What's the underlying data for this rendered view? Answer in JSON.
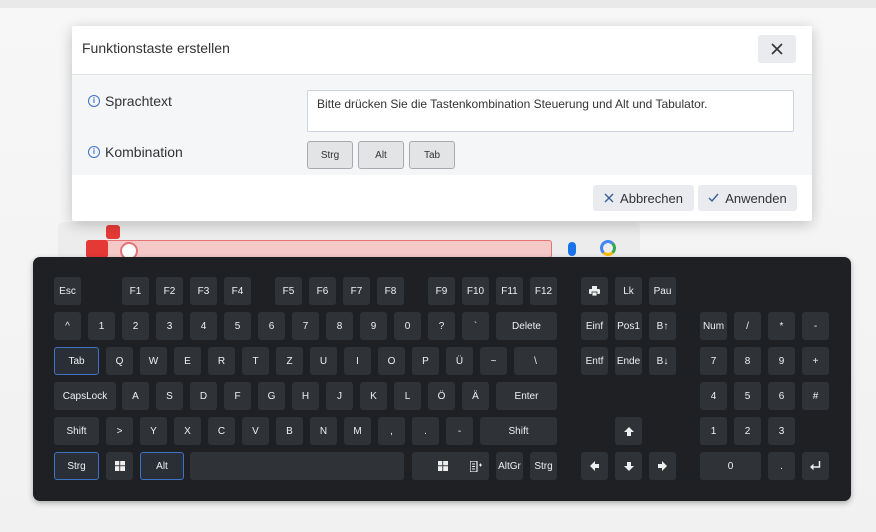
{
  "dialog": {
    "title": "Funktionstaste erstellen",
    "speech_label": "Sprachtext",
    "speech_text": "Bitte drücken Sie die Tastenkombination Steuerung und Alt und Tabulator.",
    "combo_label": "Kombination",
    "combination": [
      "Strg",
      "Alt",
      "Tab"
    ],
    "cancel_label": "Abbrechen",
    "apply_label": "Anwenden"
  },
  "keyboard": {
    "active_keys": [
      "Tab",
      "Strg",
      "Alt"
    ],
    "rows": [
      [
        "Esc",
        "F1",
        "F2",
        "F3",
        "F4",
        "F5",
        "F6",
        "F7",
        "F8",
        "F9",
        "F10",
        "F11",
        "F12",
        "print-icon",
        "Lk",
        "Pau"
      ],
      [
        "^",
        "1",
        "2",
        "3",
        "4",
        "5",
        "6",
        "7",
        "8",
        "9",
        "0",
        "?",
        "`",
        "Delete",
        "Einf",
        "Pos1",
        "B↑",
        "Num",
        "/",
        "*",
        "-"
      ],
      [
        "Tab",
        "Q",
        "W",
        "E",
        "R",
        "T",
        "Z",
        "U",
        "I",
        "O",
        "P",
        "Ü",
        "~",
        "\\",
        "Entf",
        "Ende",
        "B↓",
        "7",
        "8",
        "9",
        "+"
      ],
      [
        "CapsLock",
        "A",
        "S",
        "D",
        "F",
        "G",
        "H",
        "J",
        "K",
        "L",
        "Ö",
        "Ä",
        "Enter",
        "4",
        "5",
        "6",
        "#"
      ],
      [
        "Shift",
        ">",
        "Y",
        "X",
        "C",
        "V",
        "B",
        "N",
        "M",
        ",",
        ".",
        "-",
        "Shift",
        "up-arrow-icon",
        "1",
        "2",
        "3"
      ],
      [
        "Strg",
        "windows-icon",
        "Alt",
        "space",
        "windows-icon",
        "menu-icon",
        "AltGr",
        "Strg",
        "left-arrow-icon",
        "down-arrow-icon",
        "right-arrow-icon",
        "0",
        ".",
        "enter-icon"
      ]
    ]
  }
}
